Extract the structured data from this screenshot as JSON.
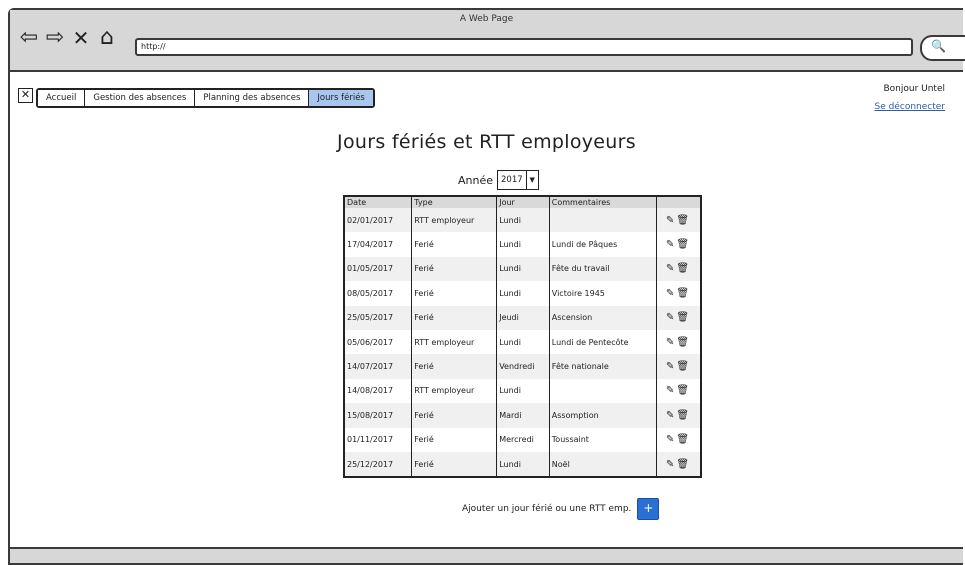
{
  "window": {
    "title": "A Web Page",
    "url": "http://"
  },
  "nav": {
    "back": "⇦",
    "forward": "⇨",
    "stop": "✕",
    "home": "⌂",
    "search": "🔍"
  },
  "tabs": [
    {
      "label": "Accueil"
    },
    {
      "label": "Gestion des absences"
    },
    {
      "label": "Planning des absences"
    },
    {
      "label": "Jours fériés",
      "active": true
    }
  ],
  "user": {
    "greeting": "Bonjour Untel",
    "logout": "Se déconnecter"
  },
  "page": {
    "title": "Jours fériés et RTT employeurs"
  },
  "year": {
    "label": "Année",
    "value": "2017"
  },
  "table": {
    "headers": [
      "Date",
      "Type",
      "Jour",
      "Commentaires",
      ""
    ],
    "rows": [
      [
        "02/01/2017",
        "RTT employeur",
        "Lundi",
        ""
      ],
      [
        "17/04/2017",
        "Ferié",
        "Lundi",
        "Lundi de Pâques"
      ],
      [
        "01/05/2017",
        "Ferié",
        "Lundi",
        "Fête du travail"
      ],
      [
        "08/05/2017",
        "Ferié",
        "Lundi",
        "Victoire 1945"
      ],
      [
        "25/05/2017",
        "Ferié",
        "Jeudi",
        "Ascension"
      ],
      [
        "05/06/2017",
        "RTT employeur",
        "Lundi",
        "Lundi de Pentecôte"
      ],
      [
        "14/07/2017",
        "Ferié",
        "Vendredi",
        "Fête nationale"
      ],
      [
        "14/08/2017",
        "RTT employeur",
        "Lundi",
        ""
      ],
      [
        "15/08/2017",
        "Ferié",
        "Mardi",
        "Assomption"
      ],
      [
        "01/11/2017",
        "Ferié",
        "Mercredi",
        "Toussaint"
      ],
      [
        "25/12/2017",
        "Ferié",
        "Lundi",
        "Noël"
      ]
    ],
    "row_actions": {
      "edit_icon": "✎",
      "delete_icon": "🗑"
    }
  },
  "add": {
    "label": "Ajouter un jour férié ou une RTT emp.",
    "button": "+"
  },
  "colors": {
    "active_tab": "#a9c7ee",
    "add_button": "#2a6fd6",
    "link": "#2e5ea8"
  }
}
